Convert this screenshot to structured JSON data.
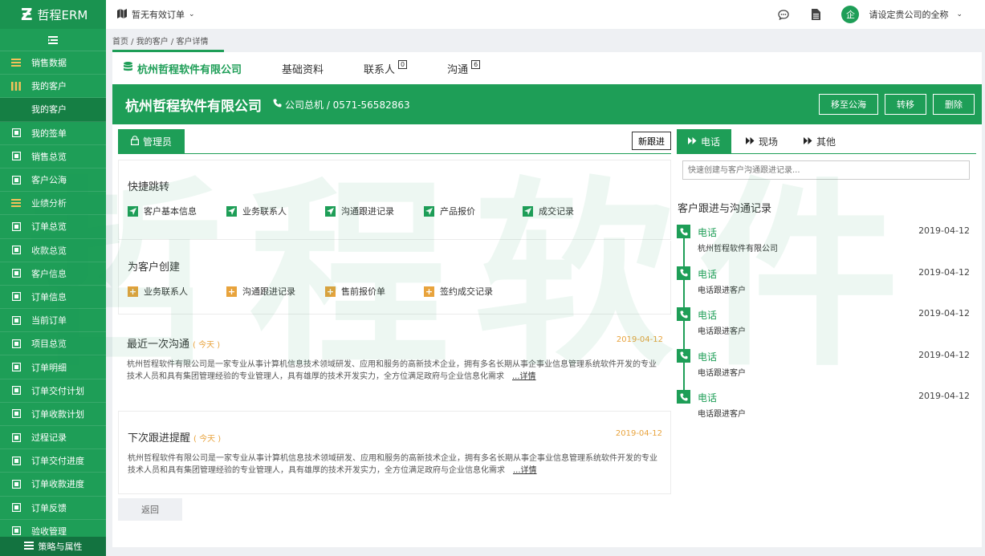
{
  "app": {
    "logo_mark": "Ƶ",
    "name": "哲程ERM"
  },
  "colors": {
    "brand": "#1e9e57",
    "accent_orange": "#e8a33c",
    "sidebar_active": "#157f44"
  },
  "sidebar": {
    "items": [
      {
        "label": "销售数据",
        "icon": "menu-lines-icon",
        "group": true
      },
      {
        "label": "我的客户",
        "icon": "columns-icon",
        "group": true
      },
      {
        "label": "我的客户",
        "icon": "",
        "active": true
      },
      {
        "label": "我的签单",
        "icon": "contract-icon"
      },
      {
        "label": "销售总览",
        "icon": "area-chart-icon"
      },
      {
        "label": "客户公海",
        "icon": "portrait-icon"
      },
      {
        "label": "业绩分析",
        "icon": "menu-lines-icon",
        "group": true
      },
      {
        "label": "订单总览",
        "icon": "grid-icon"
      },
      {
        "label": "收款总览",
        "icon": "money-icon"
      },
      {
        "label": "客户信息",
        "icon": "id-card-icon"
      },
      {
        "label": "订单信息",
        "icon": "document-icon"
      },
      {
        "label": "当前订单",
        "icon": "list-icon"
      },
      {
        "label": "项目总览",
        "icon": "table-icon"
      },
      {
        "label": "订单明细",
        "icon": "receipt-icon"
      },
      {
        "label": "订单交付计划",
        "icon": "anchor-icon"
      },
      {
        "label": "订单收款计划",
        "icon": "cube-icon"
      },
      {
        "label": "过程记录",
        "icon": "database-icon"
      },
      {
        "label": "订单交付进度",
        "icon": "pie-chart-icon"
      },
      {
        "label": "订单收款进度",
        "icon": "line-chart-icon"
      },
      {
        "label": "订单反馈",
        "icon": "reply-icon"
      },
      {
        "label": "验收管理",
        "icon": "check-icon"
      }
    ],
    "footer_label": "策略与属性"
  },
  "topbar": {
    "order_status": "暂无有效订单",
    "avatar_text": "企",
    "company_placeholder": "请设定贵公司的全称"
  },
  "breadcrumb": "首页 / 我的客户 / 客户详情",
  "tabs": [
    {
      "label": "杭州哲程软件有限公司",
      "active": true
    },
    {
      "label": "基础资料"
    },
    {
      "label": "联系人",
      "badge": "0"
    },
    {
      "label": "沟通",
      "badge": "6"
    }
  ],
  "banner": {
    "title": "杭州哲程软件有限公司",
    "phone": "公司总机 / 0571-56582863",
    "actions": [
      "移至公海",
      "转移",
      "删除"
    ]
  },
  "left": {
    "tab_label": "管理员",
    "new_followup": "新跟进",
    "quick_jump": {
      "title": "快捷跳转",
      "links": [
        "客户基本信息",
        "业务联系人",
        "沟通跟进记录",
        "产品报价",
        "成交记录"
      ]
    },
    "create": {
      "title": "为客户创建",
      "links": [
        "业务联系人",
        "沟通跟进记录",
        "售前报价单",
        "签约成交记录"
      ]
    },
    "last_comm": {
      "title": "最近一次沟通",
      "today": "( 今天 )",
      "date": "2019-04-12",
      "text": "杭州哲程软件有限公司是一家专业从事计算机信息技术领域研发、应用和服务的高新技术企业，拥有多名长期从事企事业信息管理系统软件开发的专业技术人员和具有集团管理经验的专业管理人，具有雄厚的技术开发实力，全方位满足政府与企业信息化需求",
      "more": "...详情"
    },
    "next_reminder": {
      "title": "下次跟进提醒",
      "today": "( 今天 )",
      "date": "2019-04-12",
      "text": "杭州哲程软件有限公司是一家专业从事计算机信息技术领域研发、应用和服务的高新技术企业，拥有多名长期从事企事业信息管理系统软件开发的专业技术人员和具有集团管理经验的专业管理人，具有雄厚的技术开发实力，全方位满足政府与企业信息化需求",
      "more": "...详情"
    },
    "back": "返回"
  },
  "right": {
    "tabs": [
      {
        "label": "电话",
        "active": true
      },
      {
        "label": "现场"
      },
      {
        "label": "其他"
      }
    ],
    "input_placeholder": "快速创建与客户沟通跟进记录...",
    "heading": "客户跟进与沟通记录",
    "records": [
      {
        "type": "电话",
        "date": "2019-04-12",
        "desc": "杭州哲程软件有限公司"
      },
      {
        "type": "电话",
        "date": "2019-04-12",
        "desc": "电话跟进客户"
      },
      {
        "type": "电话",
        "date": "2019-04-12",
        "desc": "电话跟进客户"
      },
      {
        "type": "电话",
        "date": "2019-04-12",
        "desc": "电话跟进客户"
      },
      {
        "type": "电话",
        "date": "2019-04-12",
        "desc": "电话跟进客户"
      }
    ]
  },
  "watermark": "哲程软件"
}
